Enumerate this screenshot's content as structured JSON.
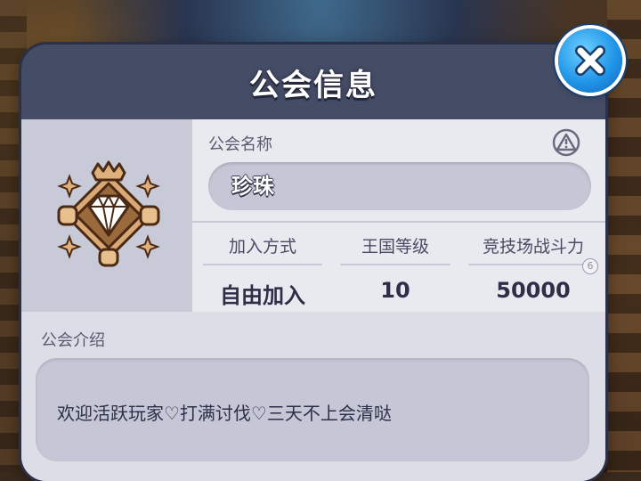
{
  "dialog": {
    "title": "公会信息"
  },
  "guild": {
    "name_label": "公会名称",
    "name": "珍珠",
    "stats": [
      {
        "label": "加入方式",
        "value": "自由加入"
      },
      {
        "label": "王国等级",
        "value": "10"
      },
      {
        "label": "竞技场战斗力",
        "value": "50000"
      }
    ],
    "intro_label": "公会介绍",
    "intro": "欢迎活跃玩家♡打满讨伐♡三天不上会清哒"
  },
  "badge": {
    "value": "6"
  },
  "icons": {
    "close": "close-icon",
    "warning": "warning-icon",
    "emblem": "diamond-guild-emblem-icon"
  },
  "colors": {
    "dialog_header": "#454c66",
    "panel_light": "#e9eaf0",
    "panel_dark": "#c9cad8",
    "close_button": "#2196e8",
    "emblem_frame": "#d9a874"
  }
}
